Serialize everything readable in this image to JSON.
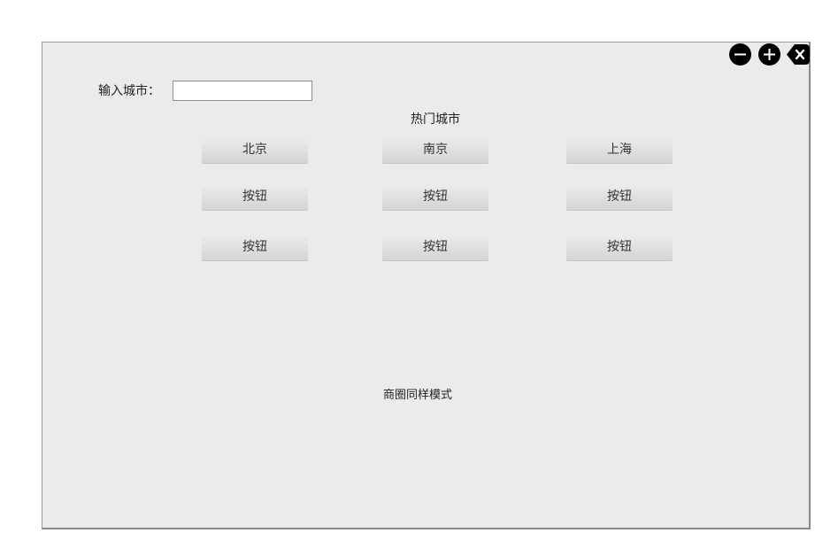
{
  "window": {
    "controls": {
      "minimize_icon": "minus-circle-icon",
      "maximize_icon": "plus-circle-icon",
      "close_icon": "close-tag-icon"
    }
  },
  "search": {
    "label": "输入城市：",
    "value": "",
    "placeholder": ""
  },
  "hot_cities": {
    "title": "热门城市",
    "buttons": [
      [
        "北京",
        "南京",
        "上海"
      ],
      [
        "按钮",
        "按钮",
        "按钮"
      ],
      [
        "按钮",
        "按钮",
        "按钮"
      ]
    ]
  },
  "business_district": {
    "note": "商圈同样模式"
  },
  "colors": {
    "panel_background": "#ebebeb",
    "panel_border": "#9a9a9a",
    "button_gradient_top": "#ececec",
    "button_gradient_bottom": "#d4d4d4",
    "window_control": "#000000"
  }
}
